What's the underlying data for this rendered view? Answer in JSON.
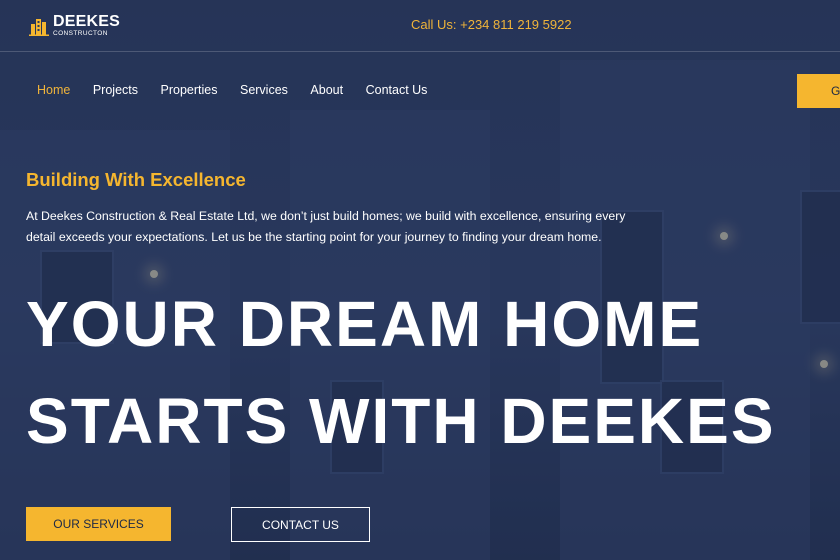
{
  "header": {
    "logo_main": "DEEKES",
    "logo_sub": "CONSTRUCTON",
    "call": "Call Us: +234 811 219 5922"
  },
  "nav": {
    "items": [
      {
        "label": "Home",
        "active": true
      },
      {
        "label": "Projects"
      },
      {
        "label": "Properties"
      },
      {
        "label": "Services"
      },
      {
        "label": "About"
      },
      {
        "label": "Contact Us"
      }
    ],
    "cta_partial": "G"
  },
  "hero": {
    "tagline": "Building With Excellence",
    "intro": "At Deekes Construction & Real Estate Ltd, we don’t just build homes; we build with excellence, ensuring every detail exceeds your expectations. Let us be the starting point for your journey to finding your dream home.",
    "headline_line1": "YOUR DREAM HOME",
    "headline_line2": "STARTS WITH DEEKES",
    "primary_button": "OUR SERVICES",
    "secondary_button": "CONTACT US"
  },
  "colors": {
    "accent": "#f5b62f",
    "background": "#2b3b60",
    "text": "#ffffff"
  }
}
